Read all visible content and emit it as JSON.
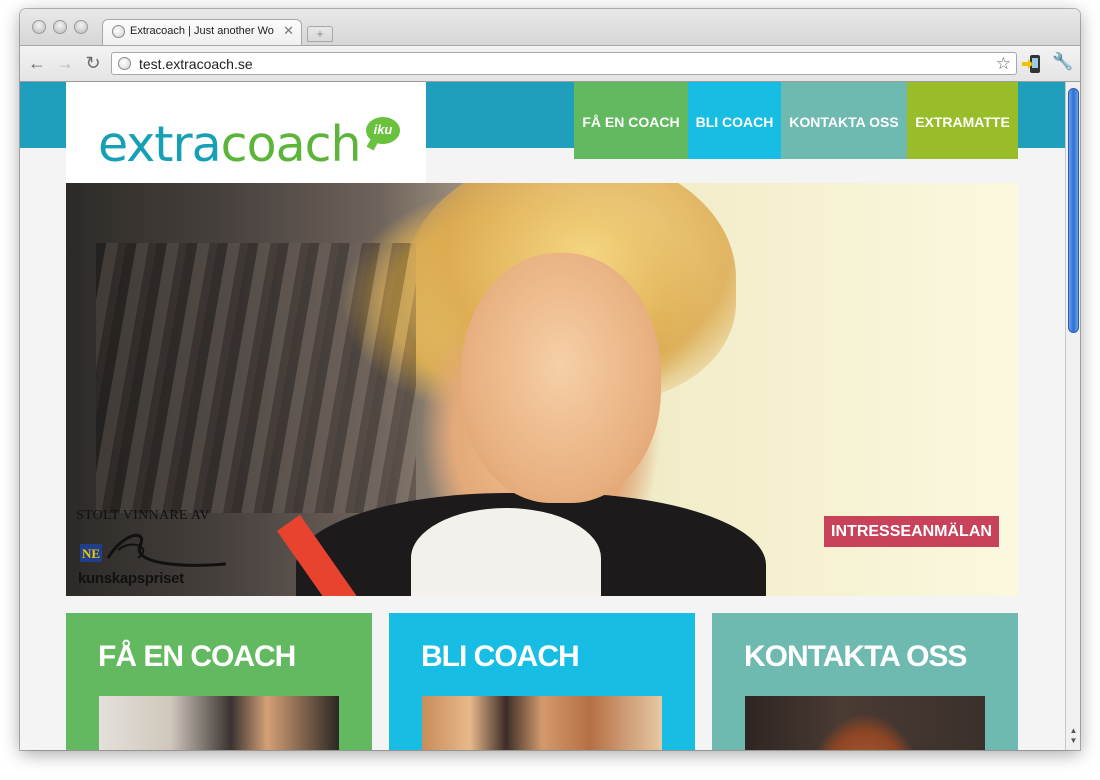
{
  "browser": {
    "tab_title": "Extracoach | Just another Wo",
    "url": "test.extracoach.se",
    "close_glyph": "✕",
    "newtab_glyph": "+",
    "back_glyph": "←",
    "forward_glyph": "→",
    "reload_glyph": "↻",
    "star_glyph": "☆",
    "wrench_glyph": "🔧",
    "scroll_up": "▲",
    "scroll_down": "▼"
  },
  "site": {
    "logo_extra": "extra",
    "logo_coach": "coach",
    "logo_bubble": "iku",
    "nav": [
      {
        "label": "FÅ EN COACH",
        "color": "#63b95f"
      },
      {
        "label": "BLI COACH",
        "color": "#18bde3"
      },
      {
        "label": "KONTAKTA OSS",
        "color": "#6ebab0"
      },
      {
        "label": "EXTRAMATTE",
        "color": "#98bd29"
      }
    ],
    "hero": {
      "award_text": "STOLT VINNARE AV",
      "award_logo_text": "NE",
      "award_name": "kunskapspriset",
      "cta_label": "INTRESSEANMÄLAN",
      "cta_color": "#c8435a"
    },
    "cards": [
      {
        "title": "FÅ EN COACH",
        "color": "#63b95f"
      },
      {
        "title": "BLI COACH",
        "color": "#18bde3"
      },
      {
        "title": "KONTAKTA OSS",
        "color": "#6ebab0"
      }
    ],
    "topband_color": "#209fbc"
  }
}
